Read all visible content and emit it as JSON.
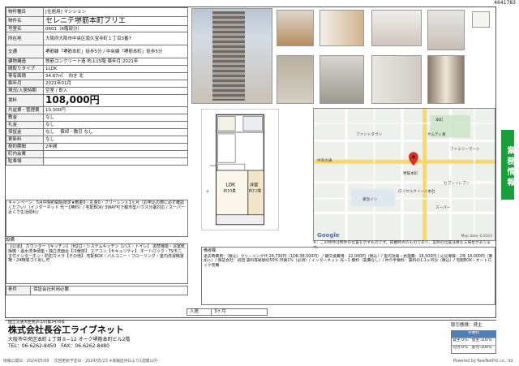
{
  "sheet_id": "4641783",
  "property": {
    "rows": [
      {
        "key": "物件種目",
        "value": "[住居用] マンション"
      },
      {
        "key": "物件名",
        "value": "セレニテ堺筋本町プリエ"
      },
      {
        "key": "号室名",
        "value": "0601（6階部分）"
      },
      {
        "key": "所在地",
        "value": "大阪府大阪市中央区南久宝寺町１丁目3番7"
      },
      {
        "key": "交通",
        "value": "堺筋線「堺筋本町」徒歩5分 / 中央線「堺筋本町」徒歩5分"
      },
      {
        "key": "建物構造",
        "value": "鉄筋コンクリート造 地上15階 築年月:2021年"
      },
      {
        "key": "間取りタイプ",
        "value": "1LDK"
      },
      {
        "key": "専有面積",
        "value": "34.87㎡　 向き 北"
      },
      {
        "key": "築年月",
        "value": "2021年01月"
      },
      {
        "key": "現況/入居時期",
        "value": "空室 / 即入"
      },
      {
        "key": "賃料",
        "value": "108,000円"
      },
      {
        "key": "共益費・管理費",
        "value": "10,300円"
      },
      {
        "key": "敷金",
        "value": "なし"
      },
      {
        "key": "礼金",
        "value": "なし"
      },
      {
        "key": "保証金",
        "value": "なし　 償却・敷引 なし"
      },
      {
        "key": "更新料",
        "value": "なし"
      },
      {
        "key": "契約期間",
        "value": "2年間"
      },
      {
        "key": "町内会費",
        "value": ""
      },
      {
        "key": "駐車場",
        "value": ""
      }
    ]
  },
  "notes": "キャンペーン：5月中契約開始限定★敷金0・礼金0・フリーレント1ヶ月（お申込の際に必ず確認ください）（インターネット 光ー1無料）/ 宅配BOX/ 3WAY可で都市型ハウス分譲対応 / スーパー近くで生活便利♪",
  "equipment_heading": "設備",
  "equipment": "【公道】 カウンター【キッチン】 IH2口・システムキッチン【バス・トイレ】 追焚機能・浴室乾燥機・温水洗浄便座・独立洗面台【冷暖房】 エアコン【セキュリティ】 オートロック・TVモニタ付インターホン・防犯カメラ【その他】 宅配BOX・バルコニー・フローリング・室内洗濯機置場・24時間ゴミ出し可",
  "conditions": {
    "key": "条件",
    "value": "保証会社利用必要"
  },
  "remarks_heading": "備考欄",
  "remarks": "退去時費用：（税込）クリーニング代 26,730円（1DK:38,500円） / 鍵交換費用：22,000円（税込）/ 室内消毒・抗菌費：16,500円 / 火災保険：2年 18,000円（要加入）/ 保証会社：初回 賃料等総額の50% 月額1%（必須）/ インターネット 光ー1 無料（実費なし）/ 仲介手数料：賃料の1.1ヶ月分（税込）/ 宅配BOX・オートロック完備",
  "period": {
    "key": "入居",
    "value": "3ヶ月"
  },
  "map": {
    "note": "※：この物件は物件の位置を示すものです。掲載時点のものであり、実際の位置は異なる場合があります。",
    "labels": [
      "ファントタウン",
      "サムティ東",
      "本町",
      "中央大通",
      "堺筋本町",
      "ロイヤルクイーン本社",
      "東急イン",
      "スーパー",
      "ファミリーマート",
      "セブンイレブン"
    ],
    "credit": "Map data ©2023",
    "logo": "Google"
  },
  "floor_plan": {
    "ldk_label": "LDK",
    "ldk_size": "約10畳",
    "western_label": "洋室",
    "western_size": "約3.2畳"
  },
  "side_tab": "業務情報",
  "footer": {
    "license": "国土交通大臣免許(10)第3478号",
    "company": "株式会社長谷工ライブネット",
    "address": "大阪市中央区本町１丁目８−12 オーク堺筋本町ビル2階",
    "tel": "TEL：06-6262-8450　FAX：06-6262-8480",
    "dates": "情報公開日：2024/05/09　 次回更新予定日：2024/05/23 ※情報提供日より2週間以内",
    "powered": "Powered by RealNetPro co., ltd."
  },
  "deal": {
    "label": "取引態様：貸主",
    "head": "手数料",
    "rows": [
      "貸主:0%　借主:100%",
      "元付:0%　客付:100%"
    ]
  }
}
